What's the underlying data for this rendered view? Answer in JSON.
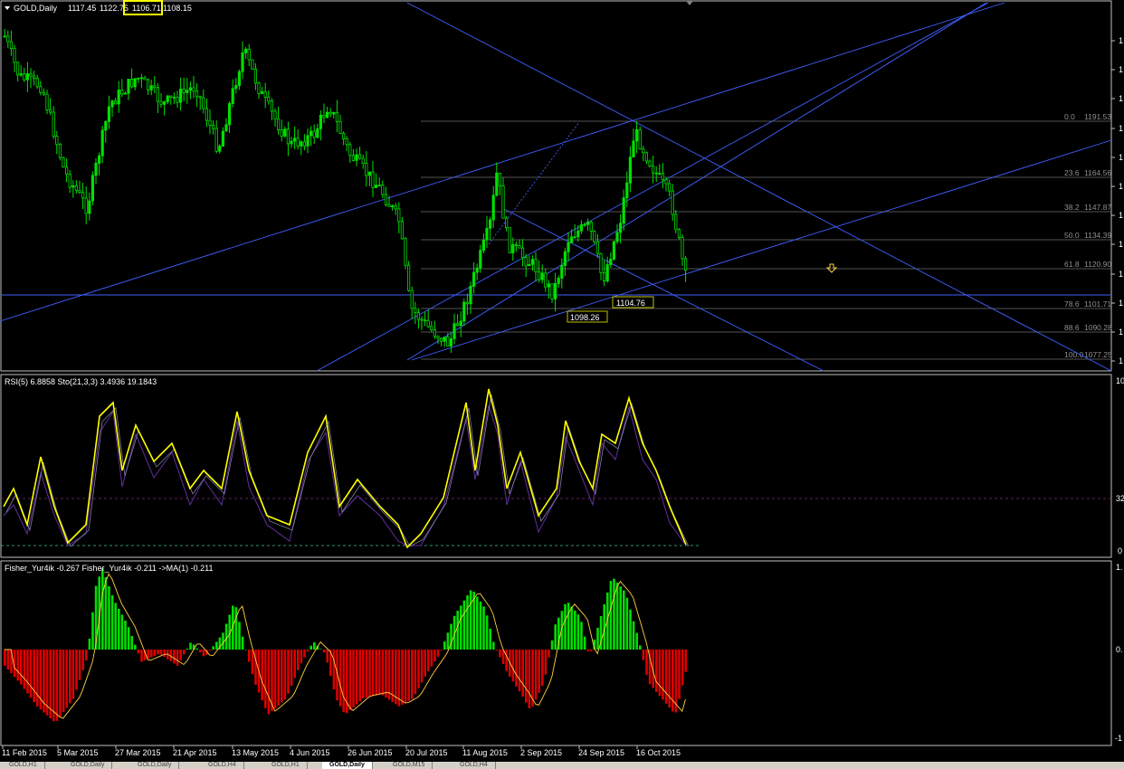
{
  "main": {
    "symbol_label": "GOLD,Daily",
    "ohlc": [
      "1117.45",
      "1122.75",
      "1106.71",
      "1108.15"
    ],
    "price_tags": [
      "1104.76",
      "1098.26"
    ],
    "fib_levels": [
      {
        "label": "0.0",
        "value": "1191.53"
      },
      {
        "label": "23.6",
        "value": "1164.56"
      },
      {
        "label": "38.2",
        "value": "1147.87"
      },
      {
        "label": "50.0",
        "value": "1134.39"
      },
      {
        "label": "61.8",
        "value": "1120.90"
      },
      {
        "label": "78.6",
        "value": "1101.71"
      },
      {
        "label": "88.6",
        "value": "1090.28"
      },
      {
        "label": "100.0",
        "value": "1077.25"
      }
    ],
    "price_axis": [
      "1",
      "1",
      "1",
      "1",
      "1",
      "1",
      "1",
      "1",
      "1",
      "1",
      "1",
      "1",
      "1",
      "1"
    ]
  },
  "rsi": {
    "label": "RSI(5) 6.8858  Sto(21,3,3) 3.4936 19.1843",
    "axis": [
      "10",
      "32",
      "0"
    ]
  },
  "fisher": {
    "label": "Fisher_Yur4ik -0.267  Fisher_Yur4ik -0.211  ->MA(1) -0.211",
    "axis": [
      "1.",
      "0.",
      "-1"
    ]
  },
  "dates": [
    "11 Feb 2015",
    "5 Mar 2015",
    "27 Mar 2015",
    "21 Apr 2015",
    "13 May 2015",
    "4 Jun 2015",
    "26 Jun 2015",
    "20 Jul 2015",
    "11 Aug 2015",
    "2 Sep 2015",
    "24 Sep 2015",
    "16 Oct 2015"
  ],
  "tabs": [
    {
      "label": "GOLD,H1"
    },
    {
      "label": "GOLD,Daily"
    },
    {
      "label": "GOLD,Daily"
    },
    {
      "label": "GOLD,H4"
    },
    {
      "label": "GOLD,H1"
    },
    {
      "label": "GOLD,Daily",
      "active": true
    },
    {
      "label": "GOLD,M15"
    },
    {
      "label": "GOLD,H4"
    }
  ],
  "colors": {
    "candle": "#00e000",
    "rsi": "#ffff00",
    "stoch": "#6030a0",
    "trendline": "#4060ff",
    "fisher_pos": "#00dd00",
    "fisher_neg": "#dd0000",
    "fisher_line": "#ffd040",
    "highlight_box": "#ffff00"
  }
}
